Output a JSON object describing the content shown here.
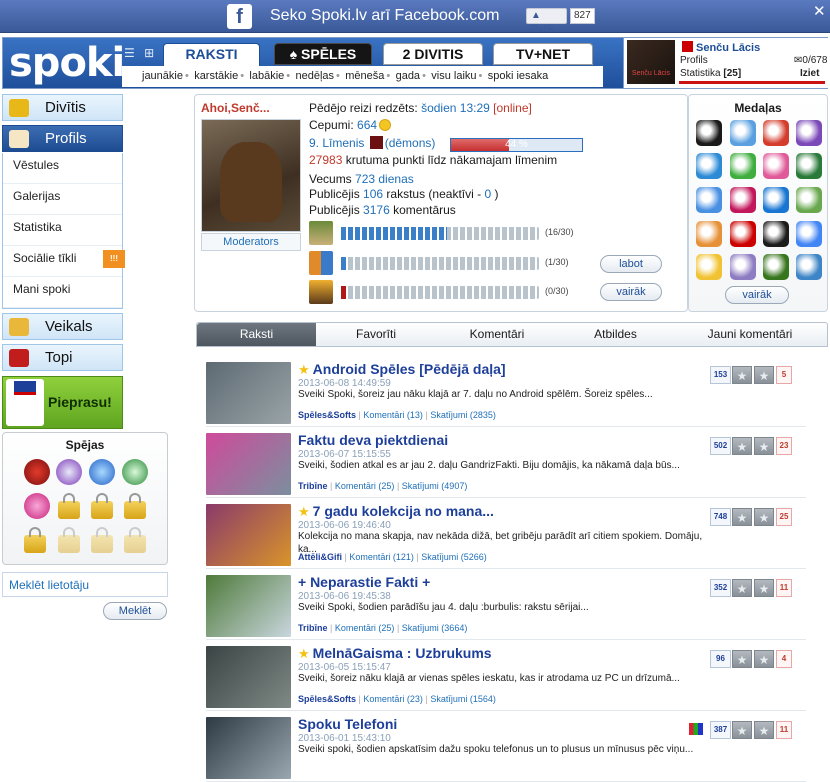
{
  "facebook_bar": {
    "icon": "f",
    "text": "Seko Spoki.lv arī Facebook.com",
    "like_label": "Patīk",
    "like_count": "827",
    "close_label": "✕"
  },
  "header": {
    "logo": "spoki",
    "view_icons": "☰ ⊞",
    "tabs": [
      {
        "label": "RAKSTI",
        "active": true
      },
      {
        "label": "SPĒLES"
      },
      {
        "label": "DIVITIS"
      },
      {
        "label": "TV+NET"
      }
    ],
    "subnav": [
      "jaunākie",
      "karstākie",
      "labākie",
      "nedēļas",
      "mēneša",
      "gada",
      "visu laiku",
      "spoki iesaka"
    ],
    "user": {
      "name": "Senču Lācis",
      "avatar_caption": "Senču Lācis",
      "profile_link": "Profils",
      "stats_label": "Statistika",
      "stats_value": "[25]",
      "mail": "0/678",
      "logout": "Iziet"
    }
  },
  "sidebar": {
    "divitis": "Divītis",
    "profils": "Profils",
    "submenu": [
      "Vēstules",
      "Galerijas",
      "Statistika",
      "Sociālie tīkli",
      "Mani spoki"
    ],
    "social_badge": "!!!",
    "veikals": "Veikals",
    "topi": "Topi",
    "pieprasu": "Pieprasu!",
    "abilities_title": "Spējas",
    "search_placeholder": "Meklēt lietotāju",
    "search_button": "Meklēt"
  },
  "profile": {
    "greeting": "Ahoi,Senč...",
    "moderators_label": "Moderators",
    "last_seen_label": "Pēdējo reizi redzēts:",
    "last_seen_value": "šodien 13:29",
    "online": "[online]",
    "cookies_label": "Cepumi:",
    "cookies_value": "664",
    "level_text": "9. Līmenis",
    "level_rank": "(dēmons)",
    "level_progress": 0.44,
    "level_progress_label": "44 %",
    "points_needed": "27983",
    "points_text": "krutuma punkti līdz nākamajam līmenim",
    "age_label": "Vecums",
    "age_value": "723 dienas",
    "published_label": "Publicējis",
    "articles_count": "106",
    "articles_text": "rakstus (neaktīvi -",
    "inactive": "0",
    "articles_close": ")",
    "comments_count": "3176",
    "comments_text": "komentārus",
    "progress_rows": [
      {
        "count": "(16/30)",
        "value": 16,
        "max": 30,
        "color": "blue"
      },
      {
        "count": "(1/30)",
        "value": 1,
        "max": 30,
        "color": "blue"
      },
      {
        "count": "(0/30)",
        "value": 1,
        "max": 30,
        "color": "red"
      }
    ],
    "edit_button": "labot",
    "more_button": "vairāk"
  },
  "medals": {
    "title": "Medaļas",
    "more_button": "vairāk",
    "colors": [
      "#1a1a1a",
      "#5aa0e0",
      "#d43c2c",
      "#7b4ab8",
      "#2d8bd6",
      "#3fae3f",
      "#e05a9a",
      "#2a7a3a",
      "#4a90e2",
      "#c2185b",
      "#1976d2",
      "#6aa84f",
      "#e69138",
      "#cc0000",
      "#1c1c1c",
      "#4285f4",
      "#f1c232",
      "#8e7cc3",
      "#38761d",
      "#3d85c6"
    ]
  },
  "content_tabs": [
    "Raksti",
    "Favorīti",
    "Komentāri",
    "Atbildes",
    "Jauni komentāri"
  ],
  "articles": [
    {
      "title": "Android Spēles [Pēdējā daļa]",
      "starred": true,
      "date": "2013-06-08 14:49:59",
      "desc": "Sveiki Spoki, šoreiz jau nāku klajā ar 7. daļu no Android spēlēm. Šoreiz spēles...",
      "category": "Spēles&Softs",
      "comments": "Komentāri (13)",
      "views": "Skatījumi (2835)",
      "view_count": "153",
      "score": "5",
      "thumb": [
        "#5d6a72",
        "#9aa4a8"
      ]
    },
    {
      "title": "Faktu deva piektdienai",
      "starred": false,
      "date": "2013-06-07 15:15:55",
      "desc": "Sveiki, šodien atkal es ar jau 2. daļu GandrizFakti. Biju domājis, ka nākamā daļa būs...",
      "category": "Tribīne",
      "comments": "Komentāri (25)",
      "views": "Skatījumi (4907)",
      "view_count": "502",
      "score": "23",
      "thumb": [
        "#d04a9c",
        "#7a8f9e"
      ]
    },
    {
      "title": "7 gadu kolekcija no mana...",
      "starred": true,
      "date": "2013-06-06 19:46:40",
      "desc": "Kolekcija no mana skapja, nav nekāda dižā, bet gribēju parādīt arī citiem spokiem. Domāju, ka...",
      "category": "Attēli&Gifi",
      "comments": "Komentāri (121)",
      "views": "Skatījumi (5266)",
      "view_count": "748",
      "score": "25",
      "thumb": [
        "#8a3a6a",
        "#d9942a"
      ]
    },
    {
      "title": "+ Neparastie Fakti +",
      "starred": false,
      "date": "2013-06-06 19:45:38",
      "desc": "Sveiki Spoki, šodien parādīšu jau 4. daļu :burbulis: rakstu sērijai...",
      "category": "Tribīne",
      "comments": "Komentāri (25)",
      "views": "Skatījumi (3664)",
      "view_count": "352",
      "score": "11",
      "thumb": [
        "#4f7a3a",
        "#c9d6de"
      ]
    },
    {
      "title": "MelnāGaisma : Uzbrukums",
      "starred": true,
      "date": "2013-06-05 15:15:47",
      "desc": "Sveiki, šoreiz nāku klajā ar vienas spēles ieskatu, kas ir atrodama uz PC un drīzumā...",
      "category": "Spēles&Softs",
      "comments": "Komentāri (23)",
      "views": "Skatījumi (1564)",
      "view_count": "96",
      "score": "4",
      "thumb": [
        "#3a4444",
        "#7f8a86"
      ]
    },
    {
      "title": "Spoku Telefoni",
      "starred": false,
      "date": "2013-06-01 15:43:10",
      "desc": "Sveiki spoki, šodien apskatīsim dažu spoku telefonus un to plusus un mīnusus pēc viņu...",
      "category": "",
      "comments": "",
      "views": "",
      "view_count": "387",
      "score": "11",
      "thumb": [
        "#2d3a44",
        "#9aa6b0"
      ]
    }
  ]
}
